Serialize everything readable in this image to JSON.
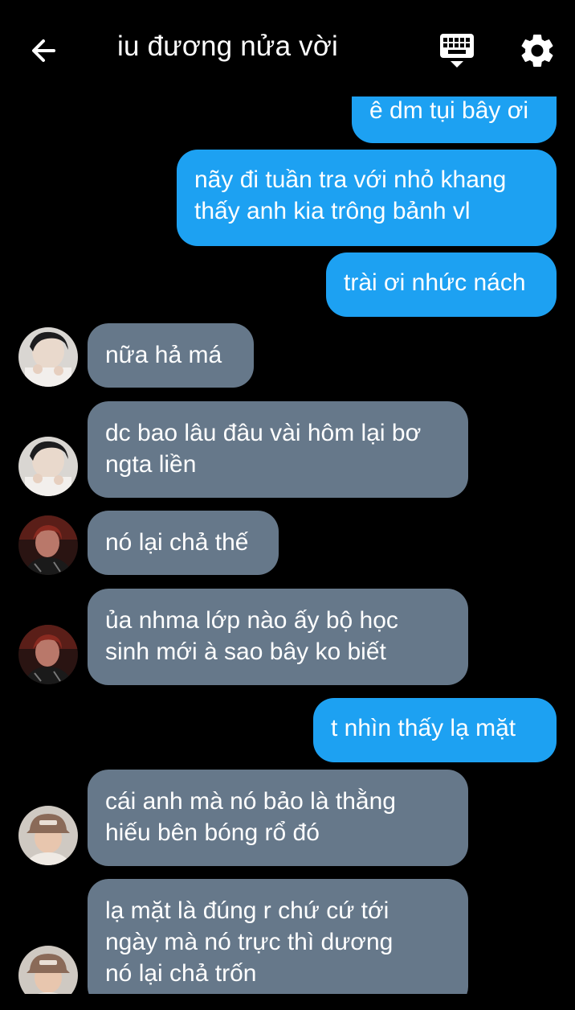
{
  "header": {
    "title": "iu đương nửa vời",
    "back_icon": "arrow-left-icon",
    "keyboard_icon": "keyboard-icon",
    "settings_icon": "gear-icon"
  },
  "colors": {
    "outgoing_bubble": "#1da1f2",
    "incoming_bubble": "#66788a",
    "background": "#000000"
  },
  "messages": [
    {
      "side": "out",
      "lines": [
        "ê dm tụi bây ơi"
      ]
    },
    {
      "side": "out",
      "lines": [
        "nãy đi tuần tra với nhỏ khang",
        "thấy anh kia trông bảnh vl"
      ]
    },
    {
      "side": "out",
      "lines": [
        "trài ơi nhức nách"
      ]
    },
    {
      "side": "in",
      "avatar": "avatar-1",
      "lines": [
        "nữa hả má"
      ]
    },
    {
      "side": "in",
      "avatar": "avatar-1",
      "lines": [
        "dc bao lâu đâu vài hôm lại bơ",
        "ngta liền"
      ]
    },
    {
      "side": "in",
      "avatar": "avatar-2",
      "lines": [
        "nó lại chả thế"
      ]
    },
    {
      "side": "in",
      "avatar": "avatar-2",
      "lines": [
        "ủa nhma lớp nào ấy bộ học",
        "sinh mới à sao bây ko biết"
      ]
    },
    {
      "side": "out",
      "lines": [
        "t nhìn thấy lạ mặt"
      ]
    },
    {
      "side": "in",
      "avatar": "avatar-3",
      "lines": [
        "cái anh mà nó bảo là thằng",
        "hiếu bên bóng rổ đó"
      ]
    },
    {
      "side": "in",
      "avatar": "avatar-3",
      "lines": [
        "lạ mặt là đúng r chứ cứ tới",
        "ngày mà nó trực thì dương",
        "nó lại chả trốn"
      ]
    }
  ]
}
